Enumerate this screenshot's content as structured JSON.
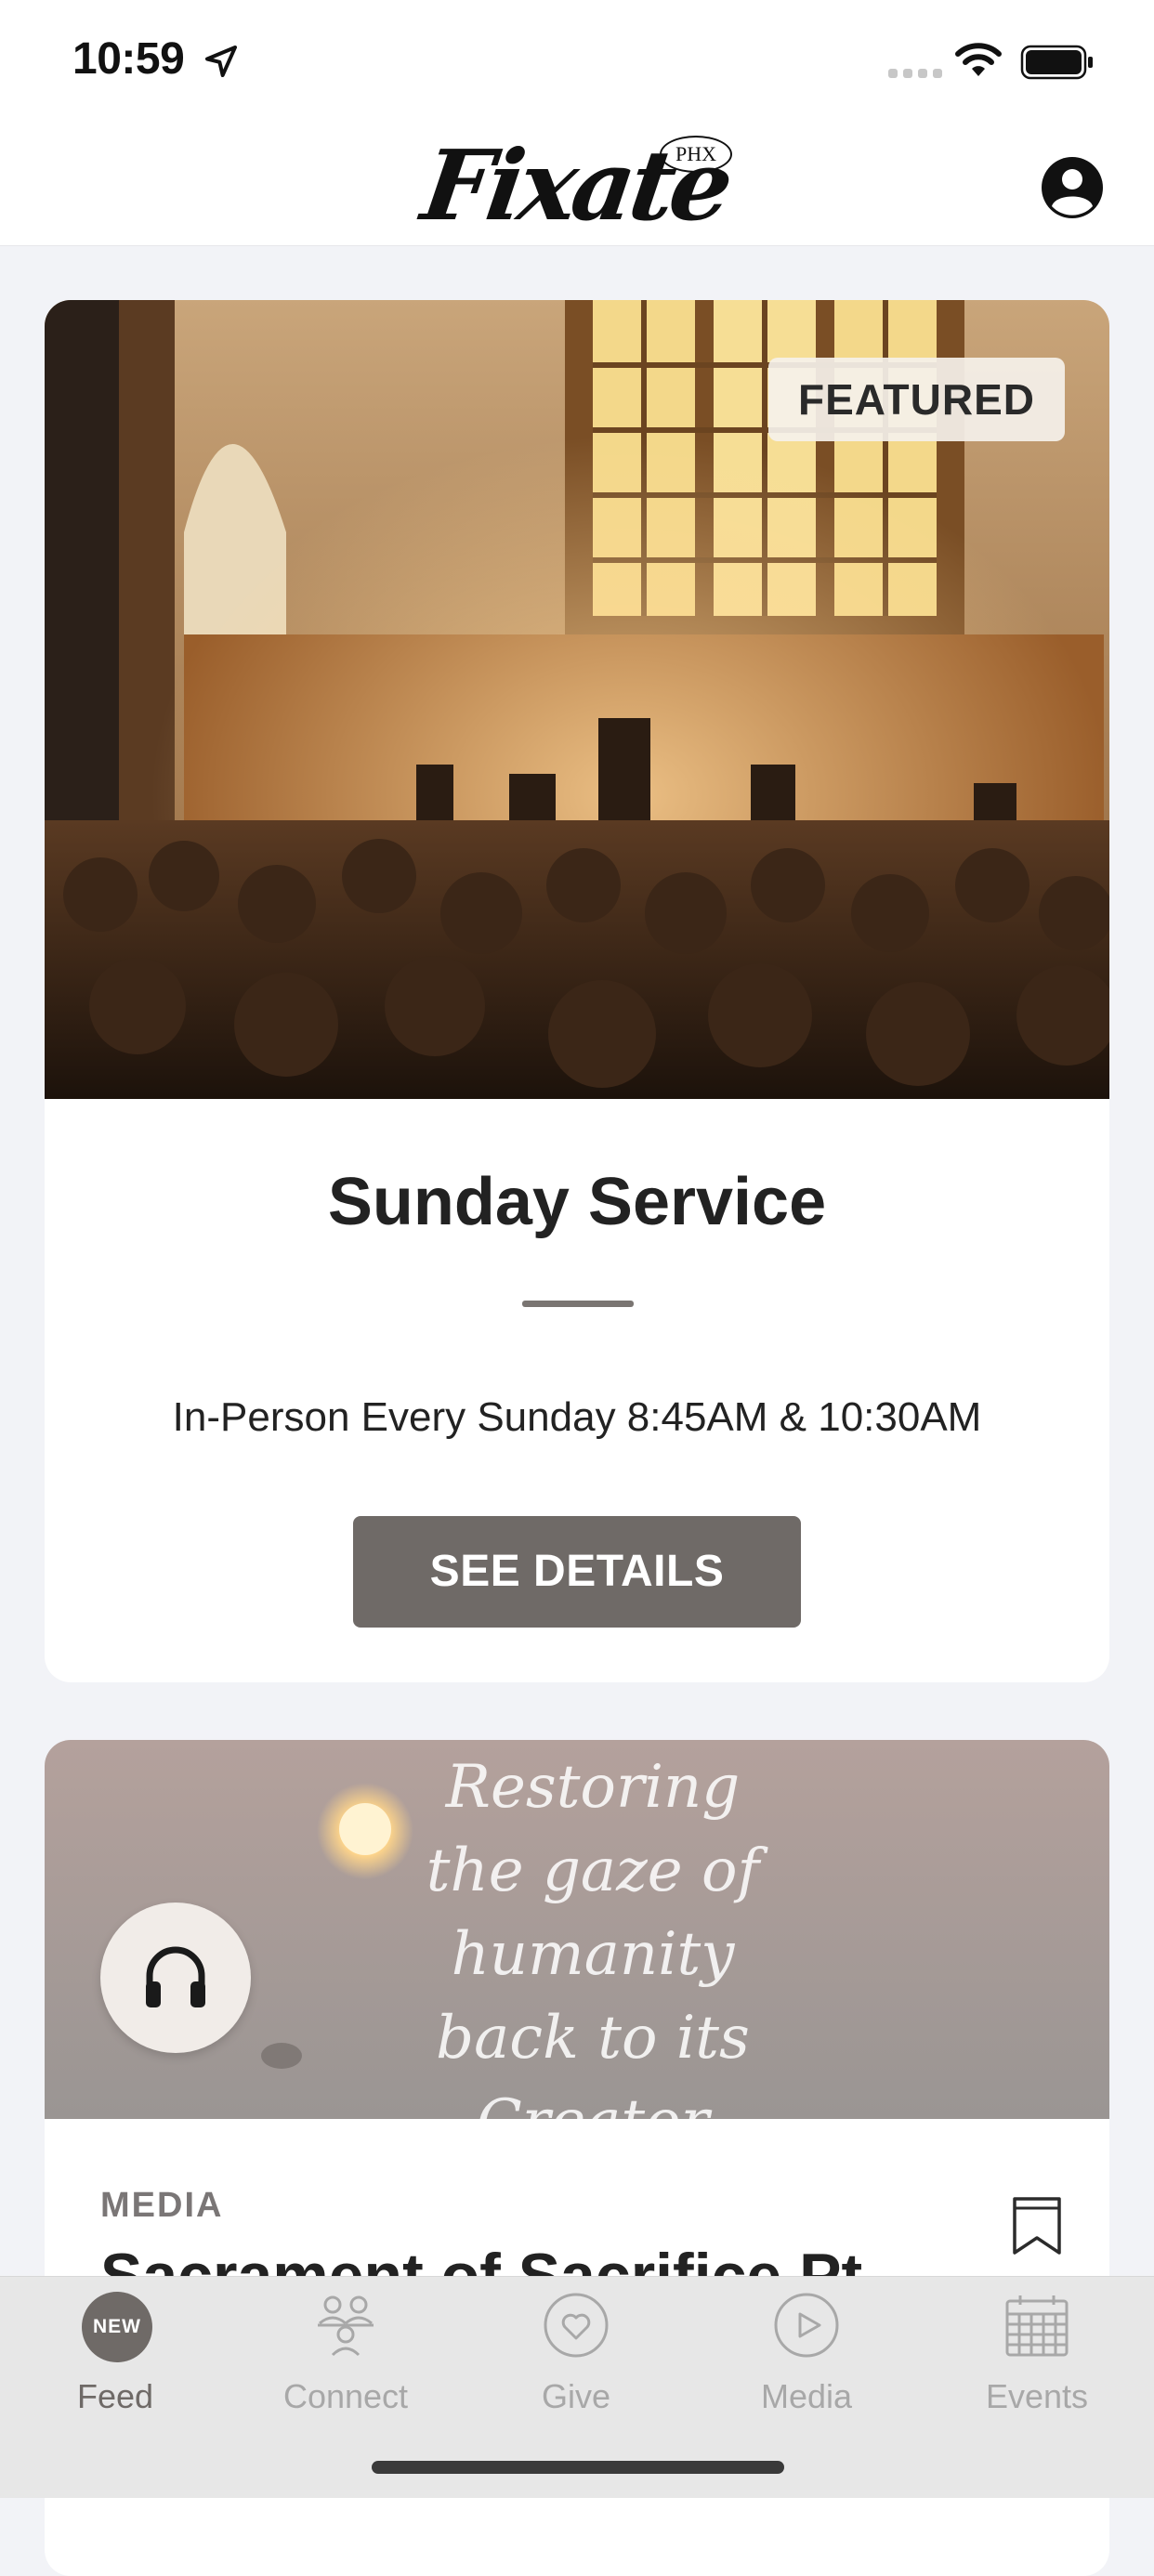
{
  "status_bar": {
    "time": "10:59",
    "icons": [
      "location-arrow-icon",
      "signal-icon",
      "wifi-icon",
      "battery-icon"
    ]
  },
  "header": {
    "logo_text": "Fixate",
    "logo_badge": "PHX",
    "profile_icon": "user-circle-icon"
  },
  "featured_card": {
    "badge": "FEATURED",
    "title": "Sunday Service",
    "subtitle": "In-Person Every Sunday 8:45AM & 10:30AM",
    "button_label": "SEE DETAILS"
  },
  "media_card": {
    "quote": "Restoring the gaze of humanity back to its Creator",
    "audio_icon": "headphones-icon",
    "tag": "MEDIA",
    "title": "Sacrament of Sacrifice Pt",
    "bookmark_icon": "bookmark-icon"
  },
  "tabbar": {
    "tabs": [
      {
        "label": "Feed",
        "icon": "new-badge-icon",
        "badge": "NEW",
        "active": true
      },
      {
        "label": "Connect",
        "icon": "people-icon",
        "active": false
      },
      {
        "label": "Give",
        "icon": "heart-icon",
        "active": false
      },
      {
        "label": "Media",
        "icon": "play-icon",
        "active": false
      },
      {
        "label": "Events",
        "icon": "calendar-icon",
        "active": false
      }
    ]
  },
  "colors": {
    "accent": "#6F6A67",
    "background": "#F2F3F7",
    "tab_inactive": "#A8A8A8"
  }
}
